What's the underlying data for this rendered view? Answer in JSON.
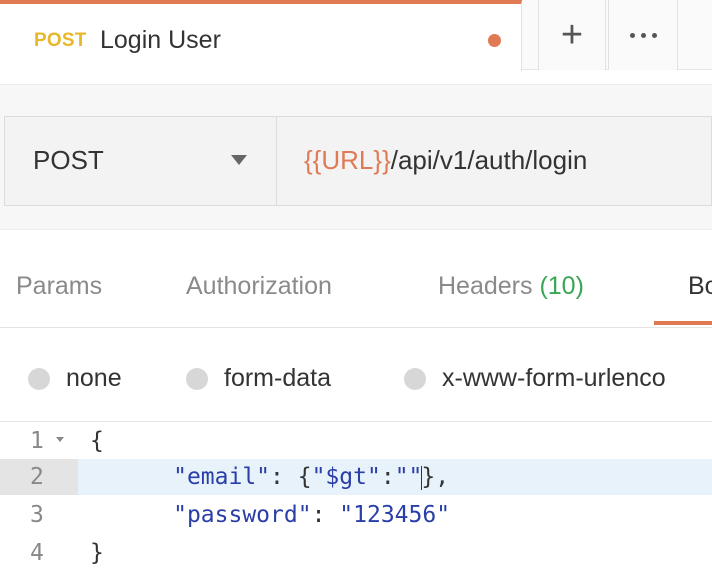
{
  "tab": {
    "method": "POST",
    "name": "Login User"
  },
  "request": {
    "method": "POST",
    "url_var": "{{URL}}",
    "url_path": "/api/v1/auth/login"
  },
  "req_tabs": {
    "params": "Params",
    "authorization": "Authorization",
    "headers": "Headers",
    "headers_count": "(10)",
    "body": "Bo"
  },
  "body_types": {
    "none": "none",
    "form_data": "form-data",
    "urlencoded": "x-www-form-urlenco"
  },
  "editor": {
    "line_numbers": [
      "1",
      "2",
      "3",
      "4"
    ],
    "line1": "{",
    "line2_key": "\"email\"",
    "line2_sep": ": {",
    "line2_val1": "\"$gt\"",
    "line2_colon": ":",
    "line2_val2": "\"\"",
    "line2_end": "},",
    "line3_key": "\"password\"",
    "line3_sep": ": ",
    "line3_val": "\"123456\"",
    "line4": "}"
  },
  "colors": {
    "accent": "#e07a55",
    "method_badge": "#e8b82a",
    "count": "#3aa655",
    "string": "#2a3ea8"
  }
}
